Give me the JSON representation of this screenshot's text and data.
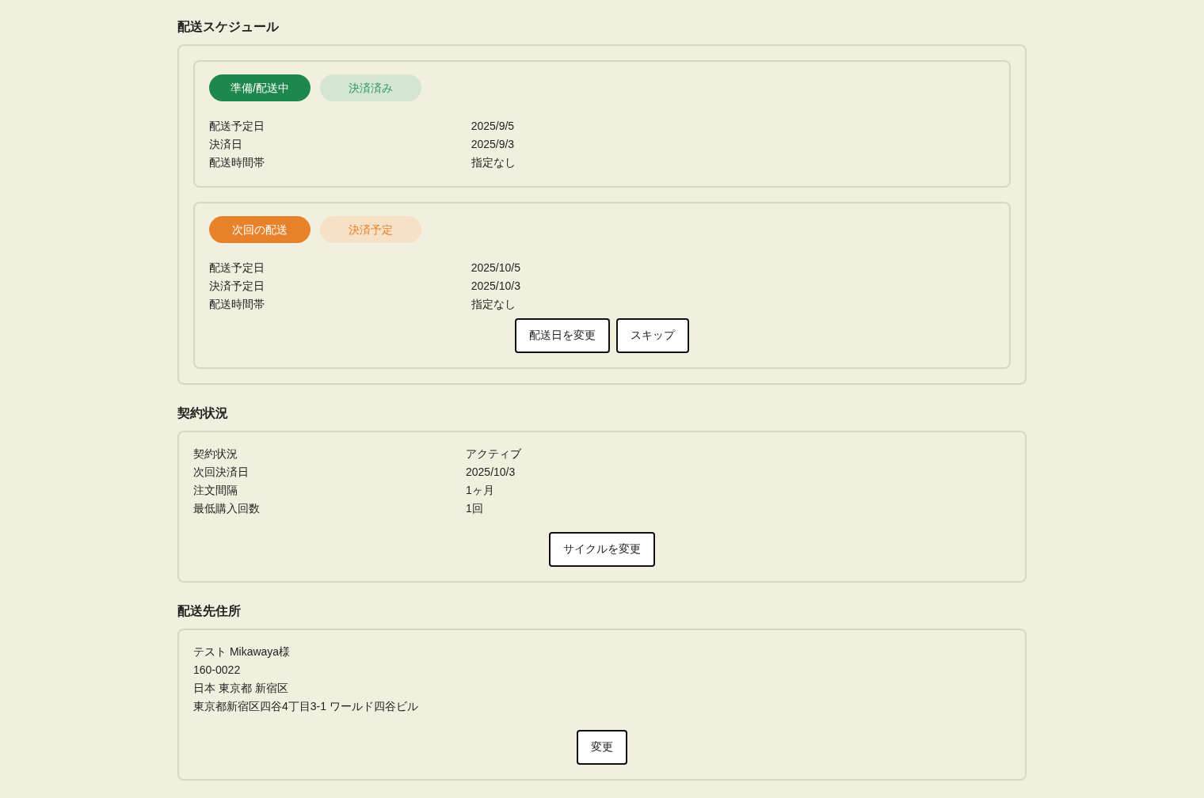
{
  "schedule": {
    "title": "配送スケジュール",
    "deliveries": [
      {
        "badges": [
          {
            "label": "準備/配送中",
            "kind": "solid",
            "color": "#1e874b"
          },
          {
            "label": "決済済み",
            "kind": "soft",
            "color": "#2e9a5f"
          }
        ],
        "rows": [
          {
            "label": "配送予定日",
            "value": "2025/9/5"
          },
          {
            "label": "決済日",
            "value": "2025/9/3"
          },
          {
            "label": "配送時間帯",
            "value": "指定なし"
          }
        ]
      },
      {
        "badges": [
          {
            "label": "次回の配送",
            "kind": "solid",
            "color": "#e8822a"
          },
          {
            "label": "決済予定",
            "kind": "soft",
            "color": "#e8822a"
          }
        ],
        "rows": [
          {
            "label": "配送予定日",
            "value": "2025/10/5"
          },
          {
            "label": "決済予定日",
            "value": "2025/10/3"
          },
          {
            "label": "配送時間帯",
            "value": "指定なし"
          }
        ],
        "buttons": [
          "配送日を変更",
          "スキップ"
        ]
      }
    ]
  },
  "contract": {
    "title": "契約状況",
    "rows": [
      {
        "label": "契約状況",
        "value": "アクティブ"
      },
      {
        "label": "次回決済日",
        "value": "2025/10/3"
      },
      {
        "label": "注文間隔",
        "value": "1ヶ月"
      },
      {
        "label": "最低購入回数",
        "value": "1回"
      }
    ],
    "buttons": [
      "サイクルを変更"
    ]
  },
  "address": {
    "title": "配送先住所",
    "lines": [
      "テスト Mikawaya様",
      "160-0022",
      "日本 東京都 新宿区",
      "東京都新宿区四谷4丁目3-1 ワールド四谷ビル"
    ],
    "buttons": [
      "変更"
    ]
  }
}
